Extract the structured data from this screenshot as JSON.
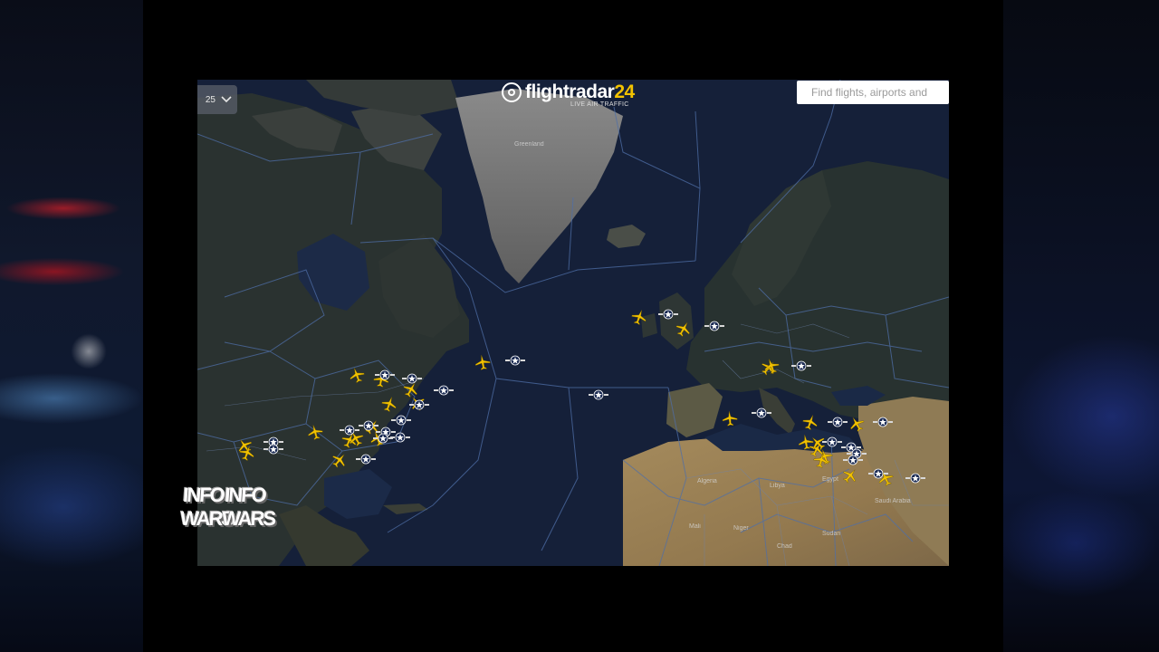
{
  "header": {
    "layer_selector_text": "25",
    "logo_name": "flightradar",
    "logo_number": "24",
    "logo_tagline": "LIVE AIR TRAFFIC"
  },
  "search": {
    "placeholder": "Find flights, airports and"
  },
  "map_labels": {
    "greenland": "Greenland",
    "algeria": "Algeria",
    "libya": "Libya",
    "egypt": "Egypt",
    "mali": "Mali",
    "niger": "Niger",
    "chad": "Chad",
    "sudan": "Sudan",
    "saudi_arabia": "Saudi Arabia"
  },
  "watermark": {
    "line1_left": "INFO",
    "line2_left": "WARS",
    "line1_right": "INFO",
    "line2_right": "WARS"
  },
  "colors": {
    "plane_yellow": "#f2c200",
    "ocean": "#152039",
    "land_dark": "#2a3232",
    "desert": "#9a8156",
    "borders": "#4f6fa8"
  }
}
